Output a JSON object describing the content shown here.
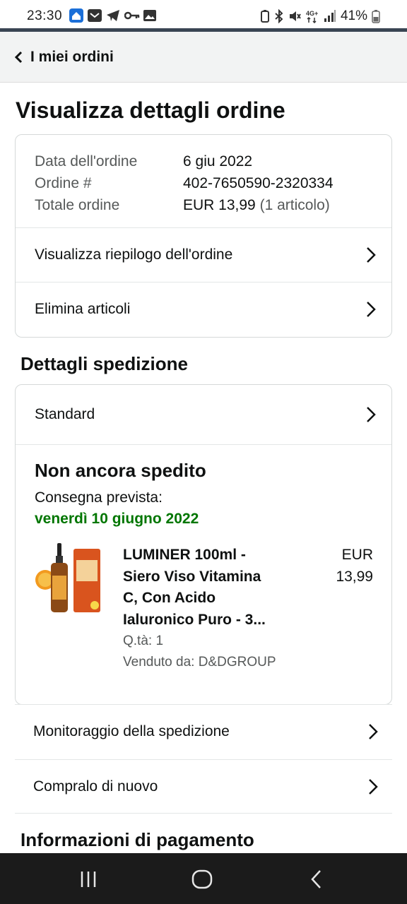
{
  "status_bar": {
    "time": "23:30",
    "battery": "41%",
    "left_icons": [
      "home-app-icon",
      "email-app-icon",
      "telegram-icon",
      "key-icon",
      "image-icon"
    ],
    "right_icons": [
      "battery-saver-icon",
      "bluetooth-icon",
      "mute-icon",
      "4g-icon",
      "signal-icon",
      "battery-icon"
    ]
  },
  "header": {
    "back_label": "I miei ordini"
  },
  "page": {
    "title": "Visualizza dettagli ordine"
  },
  "order_summary": {
    "date_label": "Data dell'ordine",
    "date_value": "6 giu 2022",
    "order_label": "Ordine #",
    "order_value": "402-7650590-2320334",
    "total_label": "Totale ordine",
    "total_value": "EUR 13,99",
    "total_items": "(1 articolo)",
    "view_summary_label": "Visualizza riepilogo dell'ordine",
    "delete_items_label": "Elimina articoli"
  },
  "shipping": {
    "section_title": "Dettagli spedizione",
    "method": "Standard",
    "status": "Non ancora spedito",
    "expected_label": "Consegna prevista:",
    "expected_date": "venerdì 10 giugno 2022",
    "product": {
      "title_line1": "LUMINER 100ml -",
      "title_line2": "Siero Viso Vitamina",
      "title_line3": "C, Con Acido",
      "title_line4": "Ialuronico Puro - 3...",
      "price_currency": "EUR",
      "price_amount": "13,99",
      "quantity": "Q.tà: 1",
      "seller": "Venduto da: D&DGROUP"
    },
    "track_label": "Monitoraggio della spedizione",
    "buy_again_label": "Compralo di nuovo"
  },
  "payment": {
    "section_title": "Informazioni di pagamento"
  },
  "colors": {
    "delivery_green": "#007600",
    "header_bg": "#f2f3f3",
    "nav_bg": "#1b1b1b"
  }
}
